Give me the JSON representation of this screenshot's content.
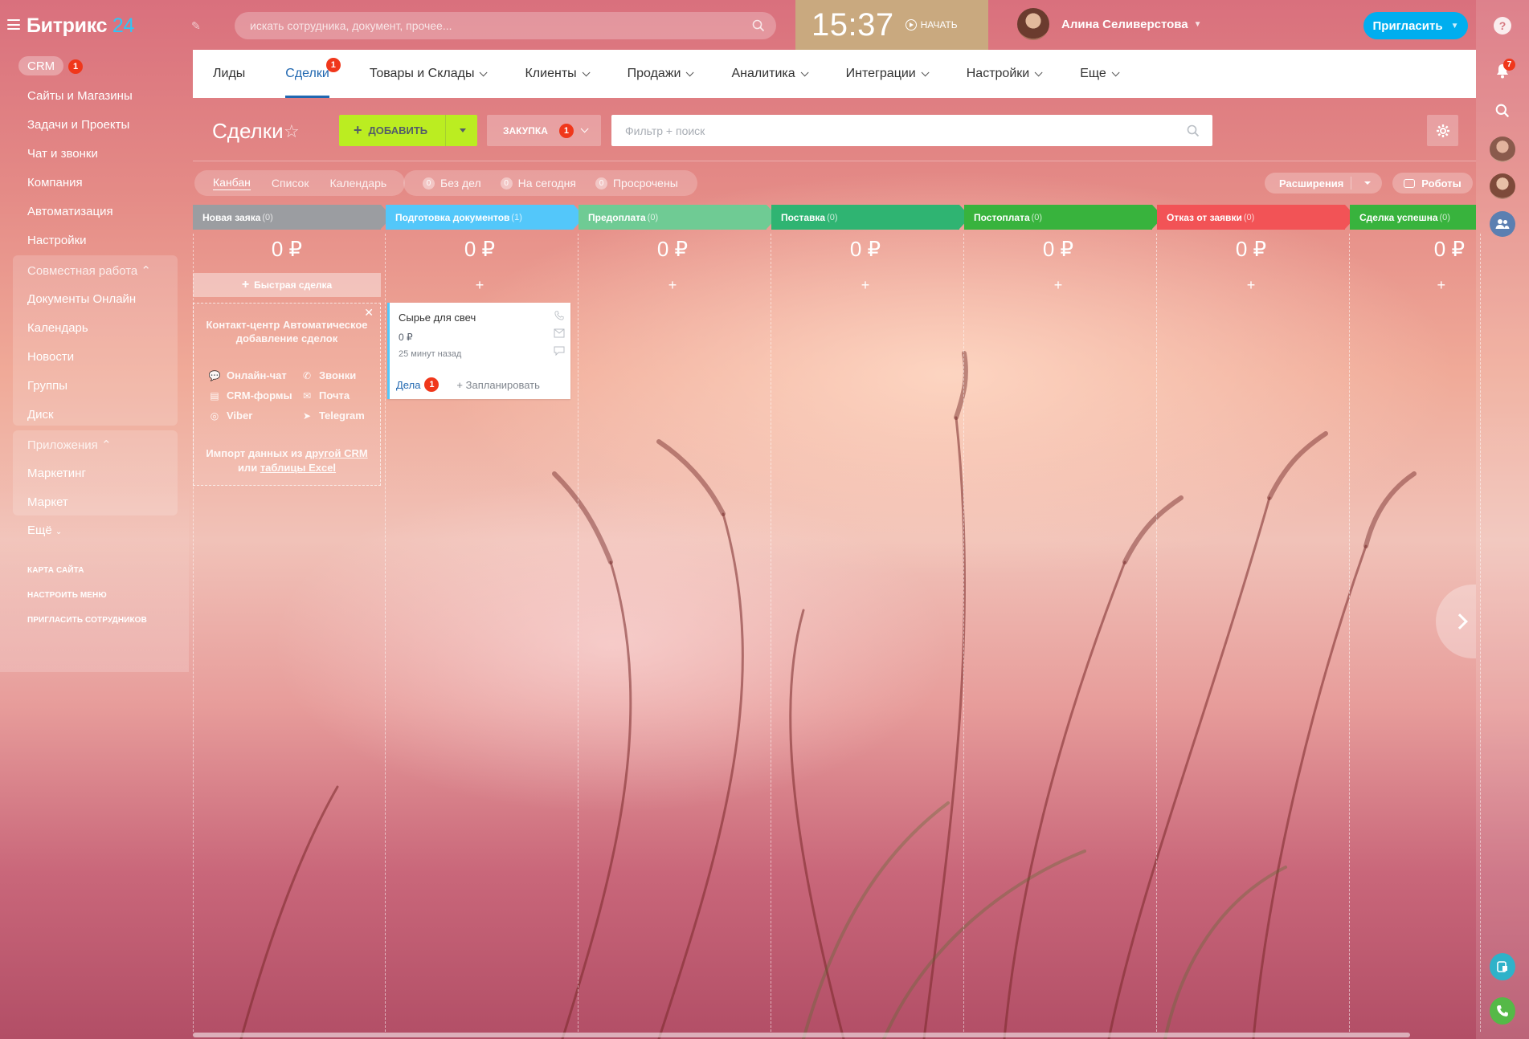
{
  "app": {
    "logo_name": "Битрикс",
    "logo_number": "24"
  },
  "header": {
    "search_placeholder": "искать сотрудника, документ, прочее...",
    "clock": "15:37",
    "start_label": "НАЧАТЬ",
    "user_name": "Алина Селиверстова",
    "invite_label": "Пригласить"
  },
  "sidebar": {
    "crm_label": "CRM",
    "crm_badge": "1",
    "items": [
      "Сайты и Магазины",
      "Задачи и Проекты",
      "Чат и звонки",
      "Компания",
      "Автоматизация",
      "Настройки"
    ],
    "group1_title": "Совместная работа",
    "group1_items": [
      "Документы Онлайн",
      "Календарь",
      "Новости",
      "Группы",
      "Диск"
    ],
    "group2_title": "Приложения",
    "group2_items": [
      "Маркетинг",
      "Маркет"
    ],
    "more": "Ещё",
    "links": [
      "Карта сайта",
      "Настроить меню",
      "Пригласить сотрудников"
    ]
  },
  "top_nav": {
    "items": [
      "Лиды",
      "Сделки",
      "Товары и Склады",
      "Клиенты",
      "Продажи",
      "Аналитика",
      "Интеграции",
      "Настройки",
      "Еще"
    ],
    "active_index": 1,
    "deals_badge": "1"
  },
  "toolbar": {
    "page_title": "Сделки",
    "add_label": "ДОБАВИТЬ",
    "funnel_label": "ЗАКУПКА",
    "funnel_badge": "1",
    "filter_placeholder": "Фильтр + поиск"
  },
  "views": {
    "items": [
      "Канбан",
      "Список",
      "Календарь"
    ],
    "active_index": 0,
    "counters": [
      {
        "count": "0",
        "label": "Без дел"
      },
      {
        "count": "0",
        "label": "На сегодня"
      },
      {
        "count": "0",
        "label": "Просрочены"
      }
    ],
    "extensions_label": "Расширения",
    "robots_label": "Роботы"
  },
  "kanban": {
    "columns": [
      {
        "name": "Новая заяка",
        "count": "(0)",
        "sum": "0 ₽",
        "color": "#9b9da1"
      },
      {
        "name": "Подготовка документов",
        "count": "(1)",
        "sum": "0 ₽",
        "color": "#53c7fa"
      },
      {
        "name": "Предоплата",
        "count": "(0)",
        "sum": "0 ₽",
        "color": "#6fcb94"
      },
      {
        "name": "Поставка",
        "count": "(0)",
        "sum": "0 ₽",
        "color": "#2fb472"
      },
      {
        "name": "Постоплата",
        "count": "(0)",
        "sum": "0 ₽",
        "color": "#38b33d"
      },
      {
        "name": "Отказ от заявки",
        "count": "(0)",
        "sum": "0 ₽",
        "color": "#f25356"
      },
      {
        "name": "Сделка успешна",
        "count": "(0)",
        "sum": "0 ₽",
        "color": "#38b33d"
      }
    ],
    "quick_deal_label": "Быстрая сделка",
    "promo": {
      "title": "Контакт-центр Автоматическое добавление сделок",
      "channels": [
        "Онлайн-чат",
        "Звонки",
        "CRM-формы",
        "Почта",
        "Viber",
        "Telegram"
      ],
      "import_text": "Импорт данных из",
      "import_link1": "другой CRM",
      "import_or": "или",
      "import_link2": "таблицы Excel"
    },
    "card": {
      "title": "Сырье для свеч",
      "price": "0 ₽",
      "time": "25 минут назад",
      "deals_label": "Дела",
      "deals_badge": "1",
      "plan_label": "+ Запланировать"
    }
  },
  "right_bar": {
    "help": "?",
    "notifications_badge": "7"
  }
}
